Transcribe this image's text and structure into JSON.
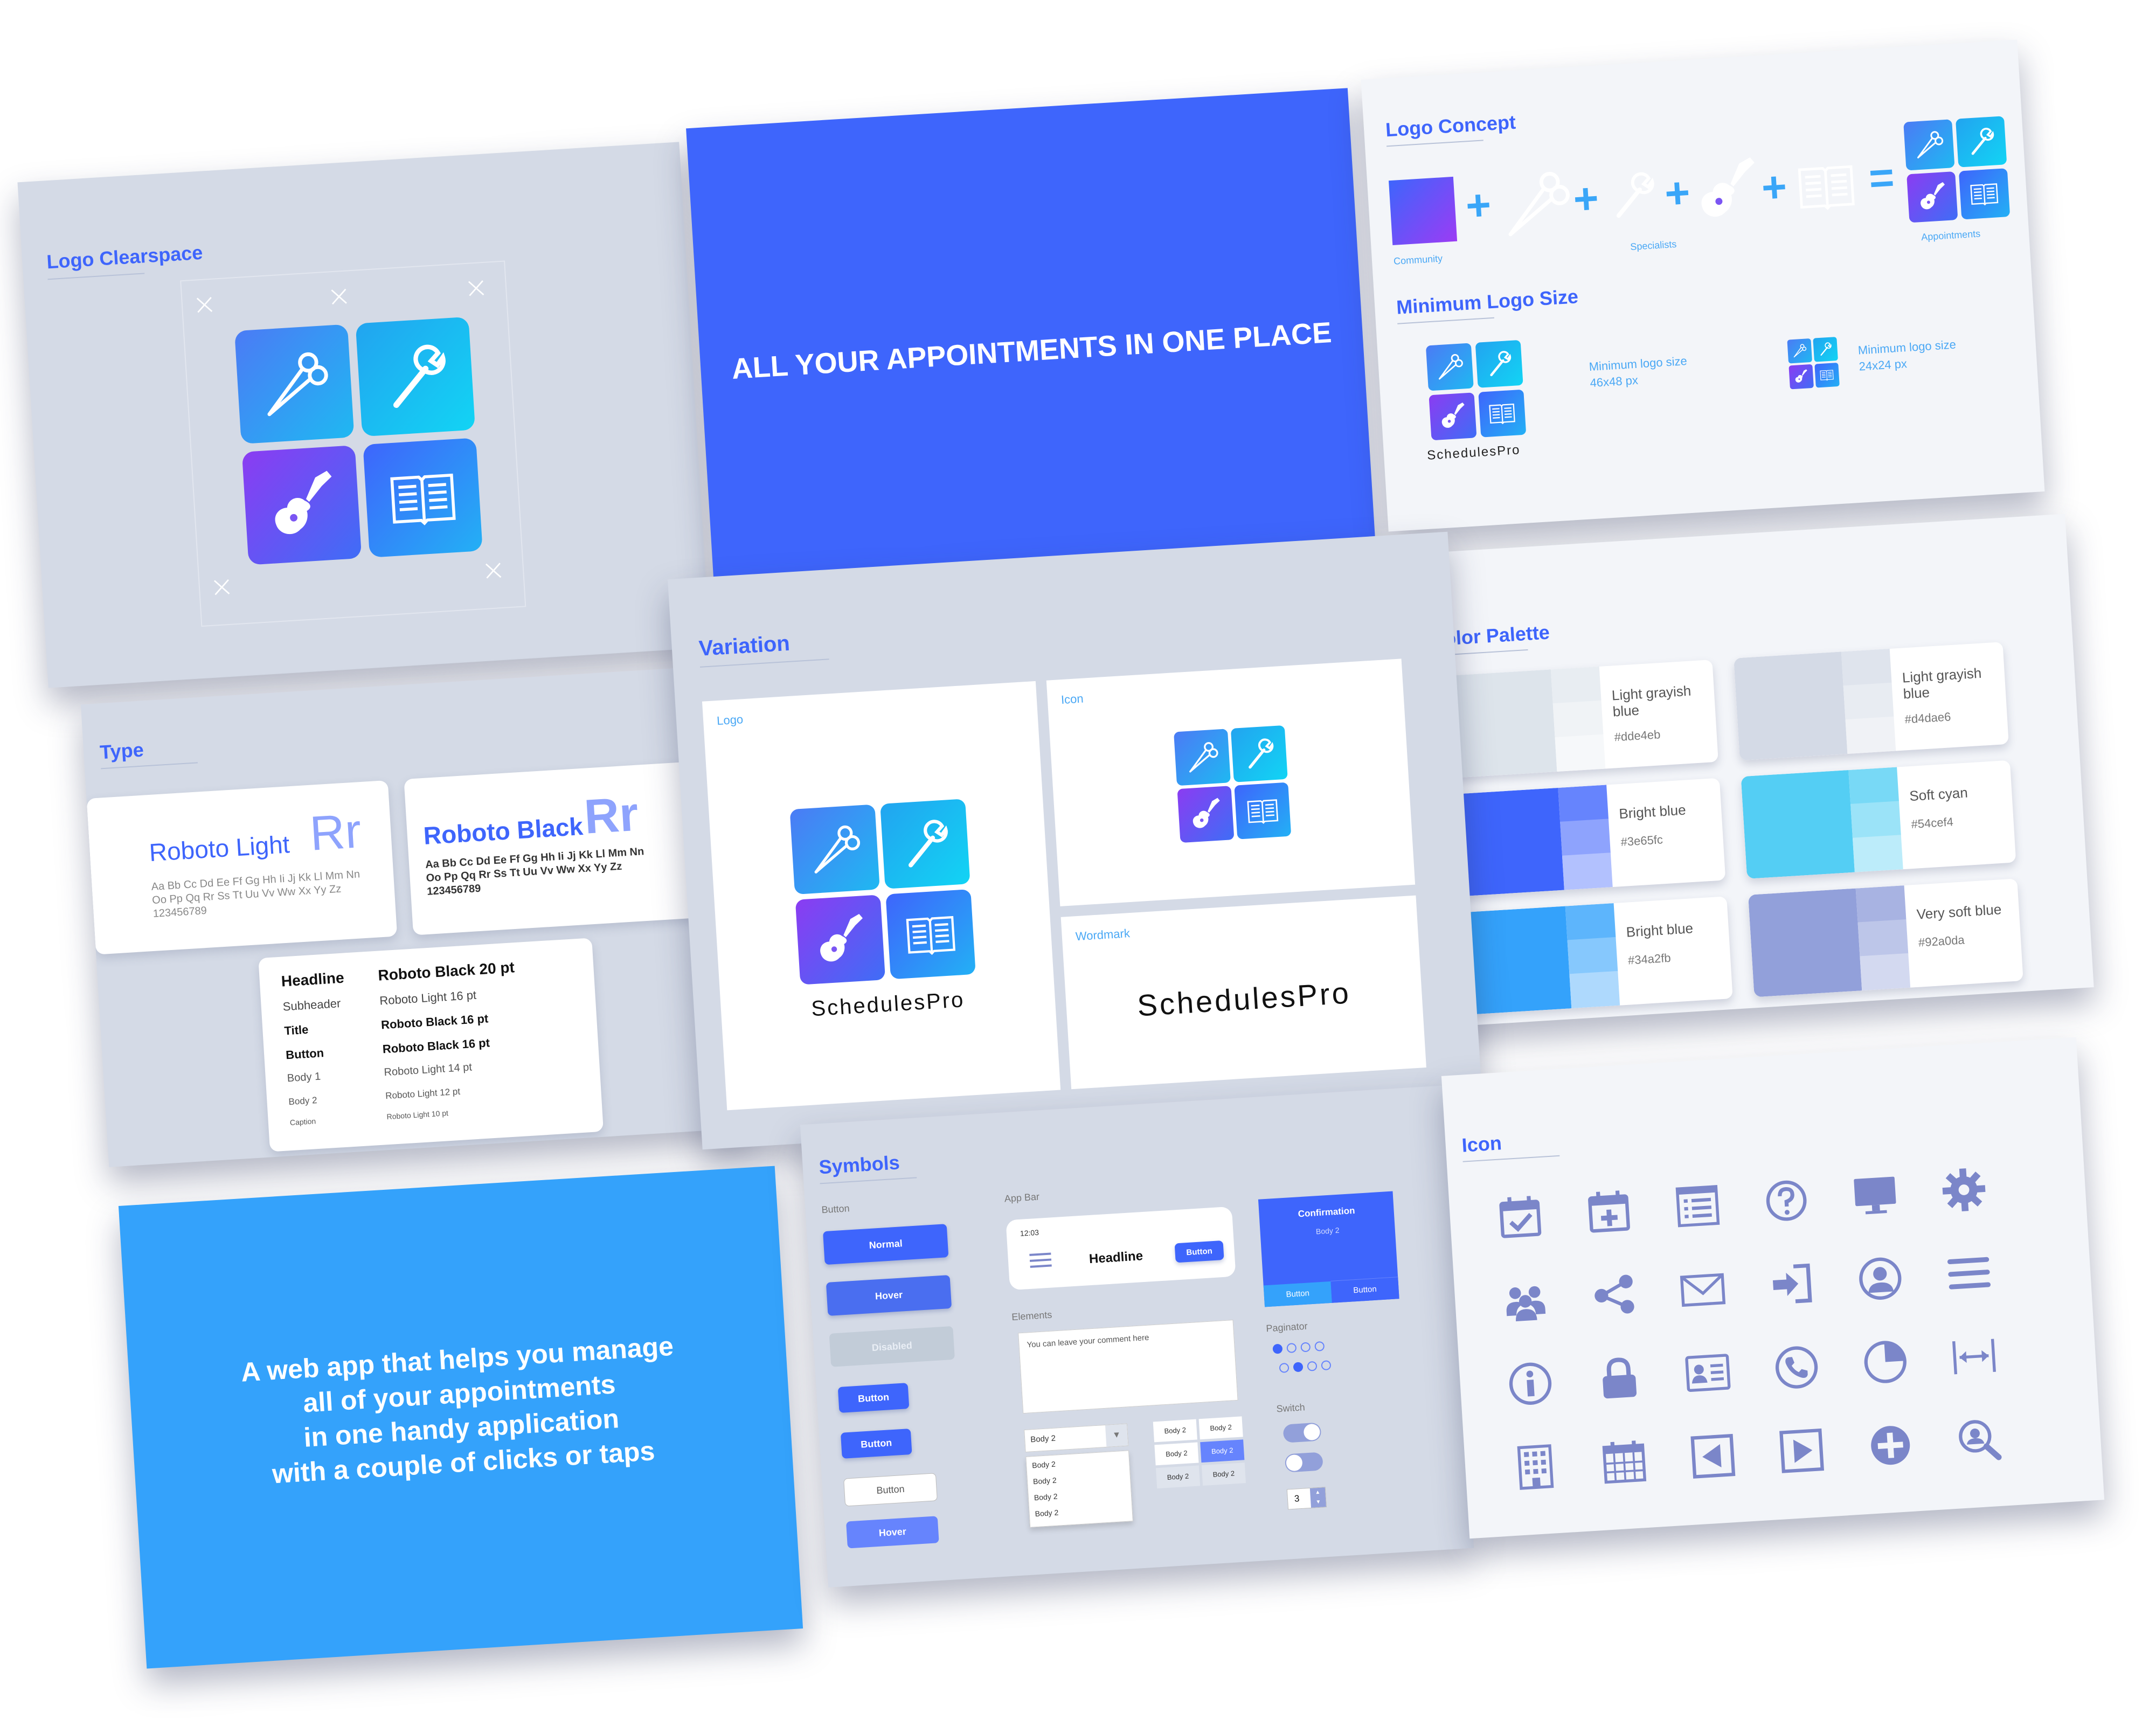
{
  "logo_clearspace": {
    "title": "Logo Clearspace",
    "x_mark": "×"
  },
  "tagline_card": {
    "text": "ALL YOUR APPOINTMENTS IN ONE PLACE"
  },
  "logo_concept": {
    "title": "Logo Concept",
    "plus": "+",
    "equals": "=",
    "labels": {
      "community": "Community",
      "specialists": "Specialists",
      "appointments": "Appointments"
    },
    "min_title": "Minimum Logo Size",
    "min_a_label": "Minimum logo size",
    "min_a_size": "46x48 px",
    "min_b_label": "Minimum logo size",
    "min_b_size": "24x24 px",
    "wordmark": "SchedulesPro"
  },
  "type": {
    "title": "Type",
    "light_name": "Roboto Light",
    "light_rr": "Rr",
    "light_sample_1": "Aa Bb Cc Dd Ee Ff Gg Hh Ii Jj Kk Ll Mm Nn",
    "light_sample_2": "Oo Pp Qq Rr Ss Tt Uu Vv Ww Xx Yy Zz",
    "light_sample_3": "123456789",
    "black_name": "Roboto Black",
    "black_rr": "Rr",
    "black_sample_1": "Aa Bb Cc Dd Ee Ff Gg Hh Ii Jj Kk Ll Mm Nn",
    "black_sample_2": "Oo Pp Qq Rr Ss Tt Uu Vv Ww Xx Yy Zz",
    "black_sample_3": "123456789",
    "scale": [
      {
        "style": "Headline",
        "spec": "Roboto Black 20 pt"
      },
      {
        "style": "Subheader",
        "spec": "Roboto Light 16 pt"
      },
      {
        "style": "Title",
        "spec": "Roboto Black 16 pt"
      },
      {
        "style": "Button",
        "spec": "Roboto Black 16 pt"
      },
      {
        "style": "Body 1",
        "spec": "Roboto Light 14 pt"
      },
      {
        "style": "Body 2",
        "spec": "Roboto Light 12 pt"
      },
      {
        "style": "Caption",
        "spec": "Roboto Light 10 pt"
      }
    ]
  },
  "variation": {
    "title": "Variation",
    "logo_label": "Logo",
    "icon_label": "Icon",
    "wordmark_label": "Wordmark",
    "wordmark": "SchedulesPro"
  },
  "color_palette": {
    "title": "Color Palette",
    "swatches": [
      {
        "name": "Light grayish blue",
        "hex": "#dde4eb",
        "color": "#dde4eb",
        "s1": "#e8edf2",
        "s2": "#f0f3f6",
        "s3": "#f6f8fa"
      },
      {
        "name": "Light grayish blue",
        "hex": "#d4dae6",
        "color": "#d4dae6",
        "s1": "#dfe4ed",
        "s2": "#e8ecf2",
        "s3": "#f0f2f6"
      },
      {
        "name": "Bright blue",
        "hex": "#3e65fc",
        "color": "#3e65fc",
        "s1": "#6684fd",
        "s2": "#8ea3fd",
        "s3": "#b2c1fe"
      },
      {
        "name": "Soft cyan",
        "hex": "#54cef4",
        "color": "#54cef4",
        "s1": "#78d9f6",
        "s2": "#9be3f8",
        "s3": "#bcecfa"
      },
      {
        "name": "Bright blue",
        "hex": "#34a2fb",
        "color": "#34a2fb",
        "s1": "#5db5fc",
        "s2": "#86c8fd",
        "s3": "#aed9fd"
      },
      {
        "name": "Very soft blue",
        "hex": "#92a0da",
        "color": "#92a0da",
        "s1": "#a8b3e2",
        "s2": "#bdc6e9",
        "s3": "#d3d9f0"
      }
    ]
  },
  "web_app_card": {
    "line_1": "A web app that helps you manage",
    "line_2": "all of your appointments",
    "line_3": "in one handy application",
    "line_4": "with a couple of clicks or taps"
  },
  "symbols": {
    "title": "Symbols",
    "button_header": "Button",
    "btn_normal": "Normal",
    "btn_hover": "Hover",
    "btn_disabled": "Disabled",
    "btn_small_1": "Button",
    "btn_small_2": "Button",
    "btn_outline": "Button",
    "btn_hover_flat": "Hover",
    "app_bar_header": "App Bar",
    "app_bar_time": "12:03",
    "app_bar_headline": "Headline",
    "app_bar_button": "Button",
    "confirmation_title": "Confirmation",
    "confirmation_body": "Body 2",
    "confirmation_btn_1": "Button",
    "confirmation_btn_2": "Button",
    "elements_header": "Elements",
    "comment_placeholder": "You can leave your comment here",
    "dropdown_value": "Body 2",
    "dropdown_options": [
      "Body 2",
      "Body 2",
      "Body 2",
      "Body 2"
    ],
    "grid_cells": [
      "Body 2",
      "Body 2",
      "Body 2",
      "Body 2",
      "Body 2",
      "Body 2"
    ],
    "paginator_header": "Paginator",
    "switch_header": "Switch",
    "stepper_value": "3"
  },
  "icon_sheet": {
    "title": "Icon",
    "color": "#7b86c9",
    "icons": [
      "calendar-check-icon",
      "calendar-add-icon",
      "list-icon",
      "help-icon",
      "monitor-icon",
      "settings-icon",
      "group-icon",
      "share-icon",
      "mail-icon",
      "login-icon",
      "user-icon",
      "menu-icon",
      "info-icon",
      "lock-icon",
      "contact-card-icon",
      "phone-icon",
      "pie-chart-icon",
      "width-icon",
      "building-icon",
      "calendar-grid-icon",
      "arrow-left-box-icon",
      "play-box-icon",
      "plus-circle-icon",
      "user-search-icon"
    ]
  }
}
